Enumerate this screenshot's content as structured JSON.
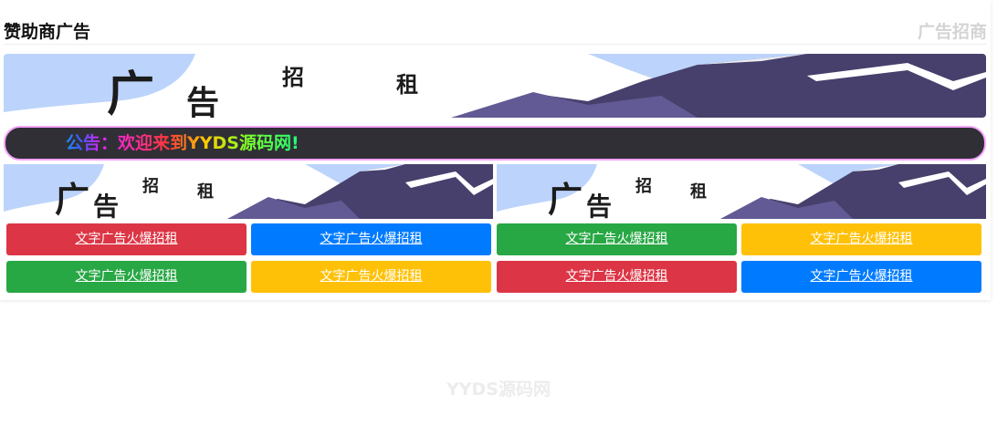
{
  "panel": {
    "title": "赞助商广告",
    "link": "广告招商"
  },
  "banners": {
    "text_guang": "广",
    "text_gao": "告",
    "text_zhao": "招",
    "text_zu": "租"
  },
  "notice": {
    "text": "公告：欢迎来到YYDS源码网!"
  },
  "ads": [
    {
      "label": "文字广告火爆招租",
      "color": "#dc3545"
    },
    {
      "label": "文字广告火爆招租",
      "color": "#007bff"
    },
    {
      "label": "文字广告火爆招租",
      "color": "#28a745"
    },
    {
      "label": "文字广告火爆招租",
      "color": "#ffc107"
    },
    {
      "label": "文字广告火爆招租",
      "color": "#28a745"
    },
    {
      "label": "文字广告火爆招租",
      "color": "#ffc107"
    },
    {
      "label": "文字广告火爆招租",
      "color": "#dc3545"
    },
    {
      "label": "文字广告火爆招租",
      "color": "#007bff"
    }
  ],
  "watermark": "YYDS源码网",
  "colors": {
    "sky": "#bcd4fb",
    "mountain_dark": "#47406c",
    "mountain_mid": "#625a94",
    "notice_bg": "#2f2f35",
    "notice_border": "#f6a3ff"
  }
}
